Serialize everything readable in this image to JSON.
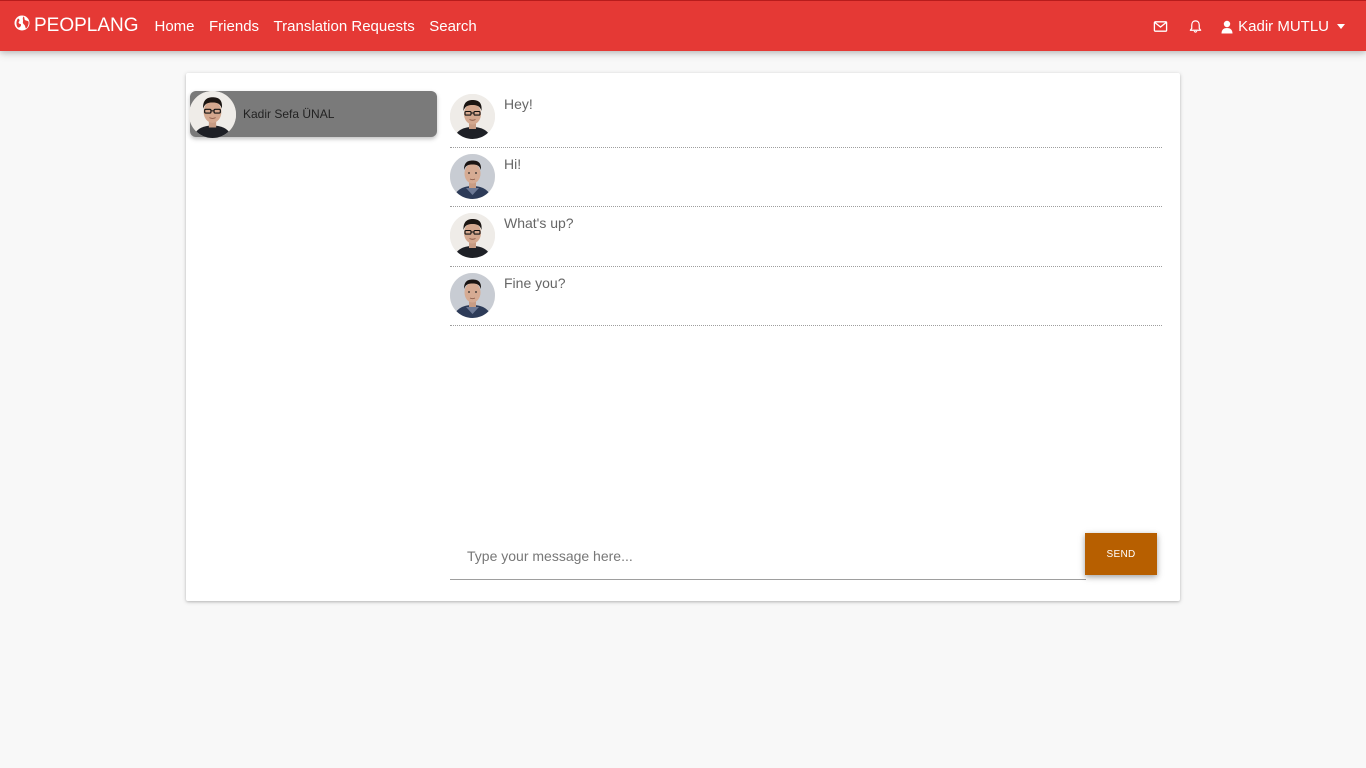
{
  "header": {
    "brand": "PEOPLANG",
    "brand_icon": "globe-icon",
    "nav": [
      {
        "label": "Home"
      },
      {
        "label": "Friends"
      },
      {
        "label": "Translation Requests"
      },
      {
        "label": "Search"
      }
    ],
    "user_name": "Kadir MUTLU",
    "icons": {
      "messages": "envelope-icon",
      "notifications": "bell-icon",
      "user": "user-icon"
    },
    "colors": {
      "navbar": "#e53935"
    }
  },
  "sidebar": {
    "contacts": [
      {
        "name": "Kadir Sefa ÜNAL",
        "active": true
      }
    ]
  },
  "chat": {
    "messages": [
      {
        "text": "Hey!",
        "sender": "glasses"
      },
      {
        "text": "Hi!",
        "sender": "other"
      },
      {
        "text": "What's up?",
        "sender": "glasses"
      },
      {
        "text": "Fine you?",
        "sender": "other"
      }
    ],
    "input_placeholder": "Type your message here...",
    "input_value": "",
    "send_label": "SEND",
    "colors": {
      "send_button": "#b75f00"
    }
  }
}
